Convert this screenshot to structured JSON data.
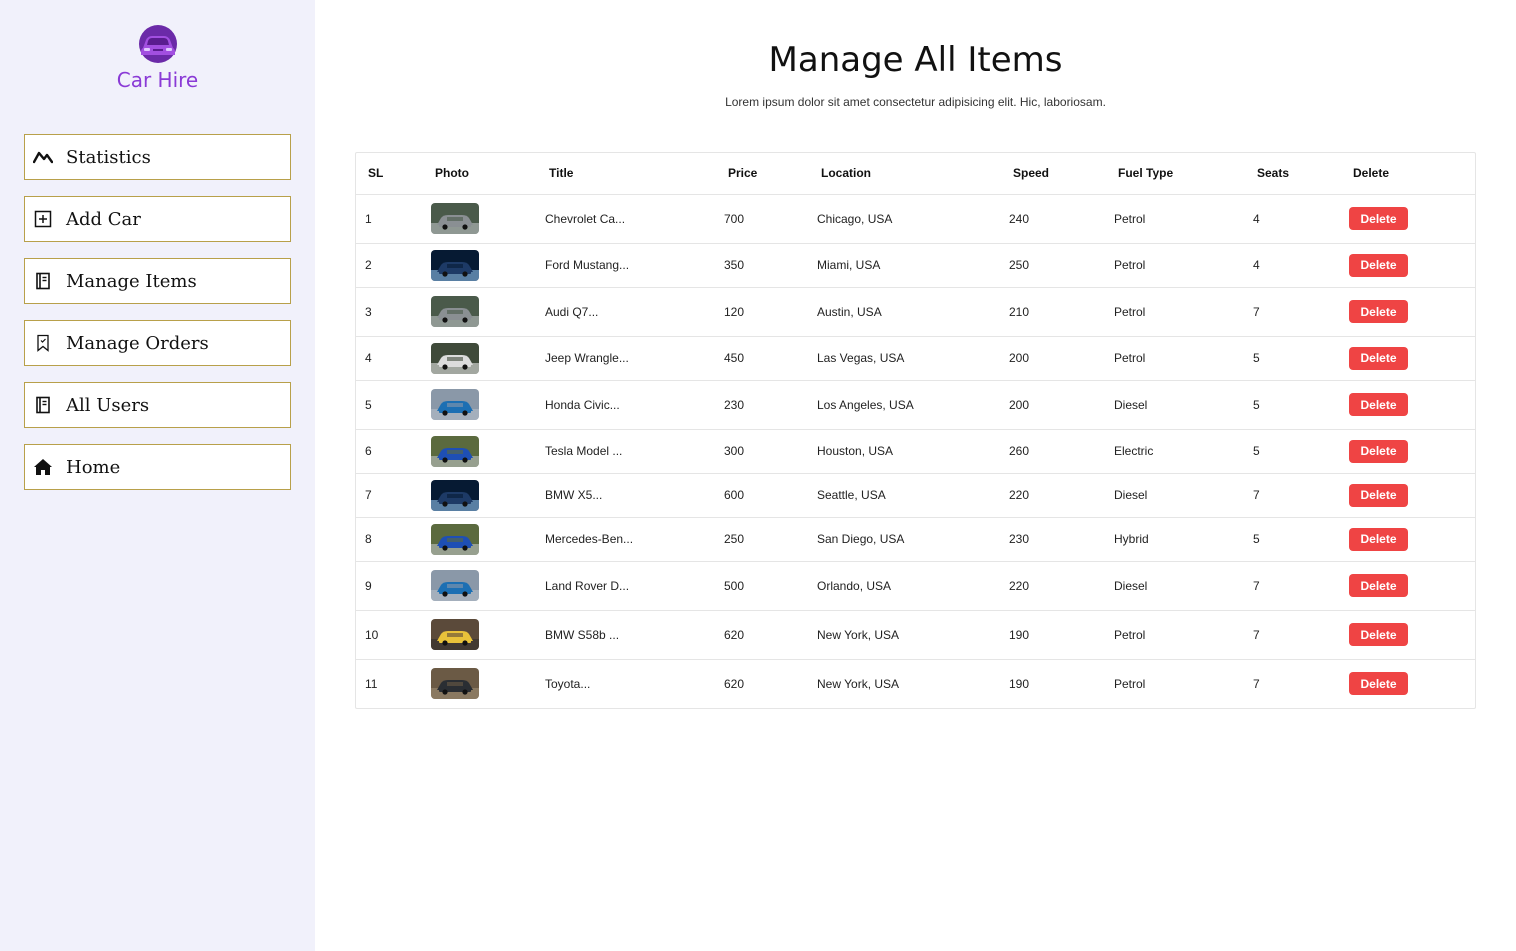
{
  "brand": {
    "name": "Car Hire",
    "color": "#8a3ad6"
  },
  "nav": [
    {
      "label": "Statistics",
      "icon": "chart-line-icon"
    },
    {
      "label": "Add Car",
      "icon": "plus-square-icon"
    },
    {
      "label": "Manage Items",
      "icon": "notebook-icon"
    },
    {
      "label": "Manage Orders",
      "icon": "bookmark-icon"
    },
    {
      "label": "All Users",
      "icon": "notebook-icon"
    },
    {
      "label": "Home",
      "icon": "home-icon"
    }
  ],
  "page": {
    "title": "Manage All Items",
    "subtitle": "Lorem ipsum dolor sit amet consectetur adipisicing elit. Hic, laboriosam."
  },
  "table": {
    "headers": [
      "SL",
      "Photo",
      "Title",
      "Price",
      "Location",
      "Speed",
      "Fuel Type",
      "Seats",
      "Delete"
    ],
    "delete_label": "Delete",
    "rows": [
      {
        "sl": "1",
        "photo": "grey-sports-car",
        "title": "Chevrolet Ca...",
        "price": "700",
        "location": "Chicago, USA",
        "speed": "240",
        "fuel": "Petrol",
        "seats": "4"
      },
      {
        "sl": "2",
        "photo": "dark-car-headlights",
        "title": "Ford Mustang...",
        "price": "350",
        "location": "Miami, USA",
        "speed": "250",
        "fuel": "Petrol",
        "seats": "4"
      },
      {
        "sl": "3",
        "photo": "grey-sports-car",
        "title": "Audi Q7...",
        "price": "120",
        "location": "Austin, USA",
        "speed": "210",
        "fuel": "Petrol",
        "seats": "7"
      },
      {
        "sl": "4",
        "photo": "white-sedan",
        "title": "Jeep Wrangle...",
        "price": "450",
        "location": "Las Vegas, USA",
        "speed": "200",
        "fuel": "Petrol",
        "seats": "5"
      },
      {
        "sl": "5",
        "photo": "blue-hatchback",
        "title": "Honda Civic...",
        "price": "230",
        "location": "Los Angeles, USA",
        "speed": "200",
        "fuel": "Diesel",
        "seats": "5"
      },
      {
        "sl": "6",
        "photo": "blue-coupe",
        "title": "Tesla Model ...",
        "price": "300",
        "location": "Houston, USA",
        "speed": "260",
        "fuel": "Electric",
        "seats": "5"
      },
      {
        "sl": "7",
        "photo": "dark-car-headlights",
        "title": "BMW X5...",
        "price": "600",
        "location": "Seattle, USA",
        "speed": "220",
        "fuel": "Diesel",
        "seats": "7"
      },
      {
        "sl": "8",
        "photo": "blue-coupe",
        "title": "Mercedes-Ben...",
        "price": "250",
        "location": "San Diego, USA",
        "speed": "230",
        "fuel": "Hybrid",
        "seats": "5"
      },
      {
        "sl": "9",
        "photo": "blue-hatchback",
        "title": "Land Rover D...",
        "price": "500",
        "location": "Orlando, USA",
        "speed": "220",
        "fuel": "Diesel",
        "seats": "7"
      },
      {
        "sl": "10",
        "photo": "yellow-sports-car",
        "title": "BMW S58b ...",
        "price": "620",
        "location": "New York, USA",
        "speed": "190",
        "fuel": "Petrol",
        "seats": "7"
      },
      {
        "sl": "11",
        "photo": "dark-car-road",
        "title": "Toyota...",
        "price": "620",
        "location": "New York, USA",
        "speed": "190",
        "fuel": "Petrol",
        "seats": "7"
      }
    ]
  },
  "colors": {
    "sidebar_bg": "#f1f1fb",
    "nav_border": "#b8a04a",
    "delete_red": "#ef4444"
  }
}
